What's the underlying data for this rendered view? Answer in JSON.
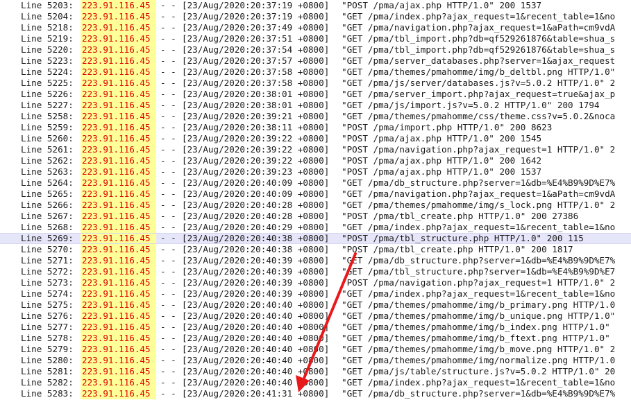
{
  "log": {
    "lines": [
      {
        "label": "Line 5203:",
        "ip": "223.91.116.45",
        "dashes": "- -",
        "timestamp": "[23/Aug/2020:20:37:19 +0800]",
        "request": "\"POST /pma/ajax.php HTTP/1.0\" 200 1537"
      },
      {
        "label": "Line 5204:",
        "ip": "223.91.116.45",
        "dashes": "- -",
        "timestamp": "[23/Aug/2020:20:37:19 +0800]",
        "request": "\"GET /pma/index.php?ajax_request=1&recent_table=1&no"
      },
      {
        "label": "Line 5218:",
        "ip": "223.91.116.45",
        "dashes": "- -",
        "timestamp": "[23/Aug/2020:20:37:49 +0800]",
        "request": "\"GET /pma/navigation.php?ajax_request=1&aPath=cm9vdA"
      },
      {
        "label": "Line 5219:",
        "ip": "223.91.116.45",
        "dashes": "- -",
        "timestamp": "[23/Aug/2020:20:37:51 +0800]",
        "request": "\"GET /pma/tbl_import.php?db=qf529261876&table=shua_s"
      },
      {
        "label": "Line 5220:",
        "ip": "223.91.116.45",
        "dashes": "- -",
        "timestamp": "[23/Aug/2020:20:37:54 +0800]",
        "request": "\"GET /pma/tbl_import.php?db=qf529261876&table=shua_s"
      },
      {
        "label": "Line 5223:",
        "ip": "223.91.116.45",
        "dashes": "- -",
        "timestamp": "[23/Aug/2020:20:37:57 +0800]",
        "request": "\"GET /pma/server_databases.php?server=1&ajax_request"
      },
      {
        "label": "Line 5224:",
        "ip": "223.91.116.45",
        "dashes": "- -",
        "timestamp": "[23/Aug/2020:20:37:58 +0800]",
        "request": "\"GET /pma/themes/pmahomme/img/b_deltbl.png HTTP/1.0\""
      },
      {
        "label": "Line 5225:",
        "ip": "223.91.116.45",
        "dashes": "- -",
        "timestamp": "[23/Aug/2020:20:37:58 +0800]",
        "request": "\"GET /pma/js/server/databases.js?v=5.0.2 HTTP/1.0\" 2"
      },
      {
        "label": "Line 5226:",
        "ip": "223.91.116.45",
        "dashes": "- -",
        "timestamp": "[23/Aug/2020:20:38:01 +0800]",
        "request": "\"GET /pma/server_import.php?ajax_request=true&ajax_p"
      },
      {
        "label": "Line 5227:",
        "ip": "223.91.116.45",
        "dashes": "- -",
        "timestamp": "[23/Aug/2020:20:38:01 +0800]",
        "request": "\"GET /pma/js/import.js?v=5.0.2 HTTP/1.0\" 200 1794"
      },
      {
        "label": "Line 5258:",
        "ip": "223.91.116.45",
        "dashes": "- -",
        "timestamp": "[23/Aug/2020:20:39:21 +0800]",
        "request": "\"GET /pma/themes/pmahomme/css/theme.css?v=5.0.2&noca"
      },
      {
        "label": "Line 5259:",
        "ip": "223.91.116.45",
        "dashes": "- -",
        "timestamp": "[23/Aug/2020:20:38:11 +0800]",
        "request": "\"POST /pma/import.php HTTP/1.0\" 200 8623"
      },
      {
        "label": "Line 5260:",
        "ip": "223.91.116.45",
        "dashes": "- -",
        "timestamp": "[23/Aug/2020:20:39:22 +0800]",
        "request": "\"POST /pma/ajax.php HTTP/1.0\" 200 1545"
      },
      {
        "label": "Line 5261:",
        "ip": "223.91.116.45",
        "dashes": "- -",
        "timestamp": "[23/Aug/2020:20:39:22 +0800]",
        "request": "\"POST /pma/navigation.php?ajax_request=1 HTTP/1.0\" 2"
      },
      {
        "label": "Line 5262:",
        "ip": "223.91.116.45",
        "dashes": "- -",
        "timestamp": "[23/Aug/2020:20:39:22 +0800]",
        "request": "\"POST /pma/ajax.php HTTP/1.0\" 200 1642"
      },
      {
        "label": "Line 5263:",
        "ip": "223.91.116.45",
        "dashes": "- -",
        "timestamp": "[23/Aug/2020:20:39:23 +0800]",
        "request": "\"POST /pma/ajax.php HTTP/1.0\" 200 1537"
      },
      {
        "label": "Line 5264:",
        "ip": "223.91.116.45",
        "dashes": "- -",
        "timestamp": "[23/Aug/2020:20:40:09 +0800]",
        "request": "\"GET /pma/db_structure.php?server=1&db=%E4%B9%9D%E7%"
      },
      {
        "label": "Line 5265:",
        "ip": "223.91.116.45",
        "dashes": "- -",
        "timestamp": "[23/Aug/2020:20:40:09 +0800]",
        "request": "\"GET /pma/navigation.php?ajax_request=1&aPath=cm9vdA"
      },
      {
        "label": "Line 5266:",
        "ip": "223.91.116.45",
        "dashes": "- -",
        "timestamp": "[23/Aug/2020:20:40:28 +0800]",
        "request": "\"GET /pma/themes/pmahomme/img/s_lock.png HTTP/1.0\" 2"
      },
      {
        "label": "Line 5267:",
        "ip": "223.91.116.45",
        "dashes": "- -",
        "timestamp": "[23/Aug/2020:20:40:28 +0800]",
        "request": "\"POST /pma/tbl_create.php HTTP/1.0\" 200 27386"
      },
      {
        "label": "Line 5268:",
        "ip": "223.91.116.45",
        "dashes": "- -",
        "timestamp": "[23/Aug/2020:20:40:29 +0800]",
        "request": "\"GET /pma/index.php?ajax_request=1&recent_table=1&no"
      },
      {
        "label": "Line 5269:",
        "ip": "223.91.116.45",
        "dashes": "- -",
        "timestamp": "[23/Aug/2020:20:40:38 +0800]",
        "request": "\"POST /pma/tbl_structure.php HTTP/1.0\" 200 115",
        "highlighted": true
      },
      {
        "label": "Line 5270:",
        "ip": "223.91.116.45",
        "dashes": "- -",
        "timestamp": "[23/Aug/2020:20:40:38 +0800]",
        "request": "\"POST /pma/tbl_create.php HTTP/1.0\" 200 1817"
      },
      {
        "label": "Line 5271:",
        "ip": "223.91.116.45",
        "dashes": "- -",
        "timestamp": "[23/Aug/2020:20:40:39 +0800]",
        "request": "\"GET /pma/db_structure.php?server=1&db=%E4%B9%9D%E7%"
      },
      {
        "label": "Line 5272:",
        "ip": "223.91.116.45",
        "dashes": "- -",
        "timestamp": "[23/Aug/2020:20:40:39 +0800]",
        "request": "\"GET /pma/tbl_structure.php?server=1&db=%E4%B9%9D%E7"
      },
      {
        "label": "Line 5273:",
        "ip": "223.91.116.45",
        "dashes": "- -",
        "timestamp": "[23/Aug/2020:20:40:39 +0800]",
        "request": "\"POST /pma/navigation.php?ajax_request=1 HTTP/1.0\" 2"
      },
      {
        "label": "Line 5274:",
        "ip": "223.91.116.45",
        "dashes": "- -",
        "timestamp": "[23/Aug/2020:20:40:39 +0800]",
        "request": "\"GET /pma/index.php?ajax_request=1&recent_table=1&no"
      },
      {
        "label": "Line 5275:",
        "ip": "223.91.116.45",
        "dashes": "- -",
        "timestamp": "[23/Aug/2020:20:40:40 +0800]",
        "request": "\"GET /pma/themes/pmahomme/img/b_primary.png HTTP/1.0"
      },
      {
        "label": "Line 5276:",
        "ip": "223.91.116.45",
        "dashes": "- -",
        "timestamp": "[23/Aug/2020:20:40:40 +0800]",
        "request": "\"GET /pma/themes/pmahomme/img/b_unique.png HTTP/1.0\""
      },
      {
        "label": "Line 5277:",
        "ip": "223.91.116.45",
        "dashes": "- -",
        "timestamp": "[23/Aug/2020:20:40:40 +0800]",
        "request": "\"GET /pma/themes/pmahomme/img/b_index.png HTTP/1.0\""
      },
      {
        "label": "Line 5278:",
        "ip": "223.91.116.45",
        "dashes": "- -",
        "timestamp": "[23/Aug/2020:20:40:40 +0800]",
        "request": "\"GET /pma/themes/pmahomme/img/b_ftext.png HTTP/1.0\""
      },
      {
        "label": "Line 5279:",
        "ip": "223.91.116.45",
        "dashes": "- -",
        "timestamp": "[23/Aug/2020:20:40:40 +0800]",
        "request": "\"GET /pma/themes/pmahomme/img/b_move.png HTTP/1.0\" 2"
      },
      {
        "label": "Line 5280:",
        "ip": "223.91.116.45",
        "dashes": "- -",
        "timestamp": "[23/Aug/2020:20:40:40 +0800]",
        "request": "\"GET /pma/themes/pmahomme/img/normalize.png HTTP/1.0"
      },
      {
        "label": "Line 5281:",
        "ip": "223.91.116.45",
        "dashes": "- -",
        "timestamp": "[23/Aug/2020:20:40:40 +0800]",
        "request": "\"GET /pma/js/table/structure.js?v=5.0.2 HTTP/1.0\" 20"
      },
      {
        "label": "Line 5282:",
        "ip": "223.91.116.45",
        "dashes": "- -",
        "timestamp": "[23/Aug/2020:20:40:40 +0800]",
        "request": "\"GET /pma/index.php?ajax_request=1&recent_table=1&no"
      },
      {
        "label": "Line 5283:",
        "ip": "223.91.116.45",
        "dashes": "- -",
        "timestamp": "[23/Aug/2020:20:41:31 +0800]",
        "request": "\"GET /pma/db_structure.php?server=1&db=%E4%B9%9D%E7%"
      }
    ]
  },
  "colors": {
    "ip_text": "#e00000",
    "ip_background": "#ffff99",
    "highlight_background": "#e6e6fa",
    "arrow": "#e8191b"
  },
  "icons": {
    "annotation": "red-arrow-icon"
  }
}
